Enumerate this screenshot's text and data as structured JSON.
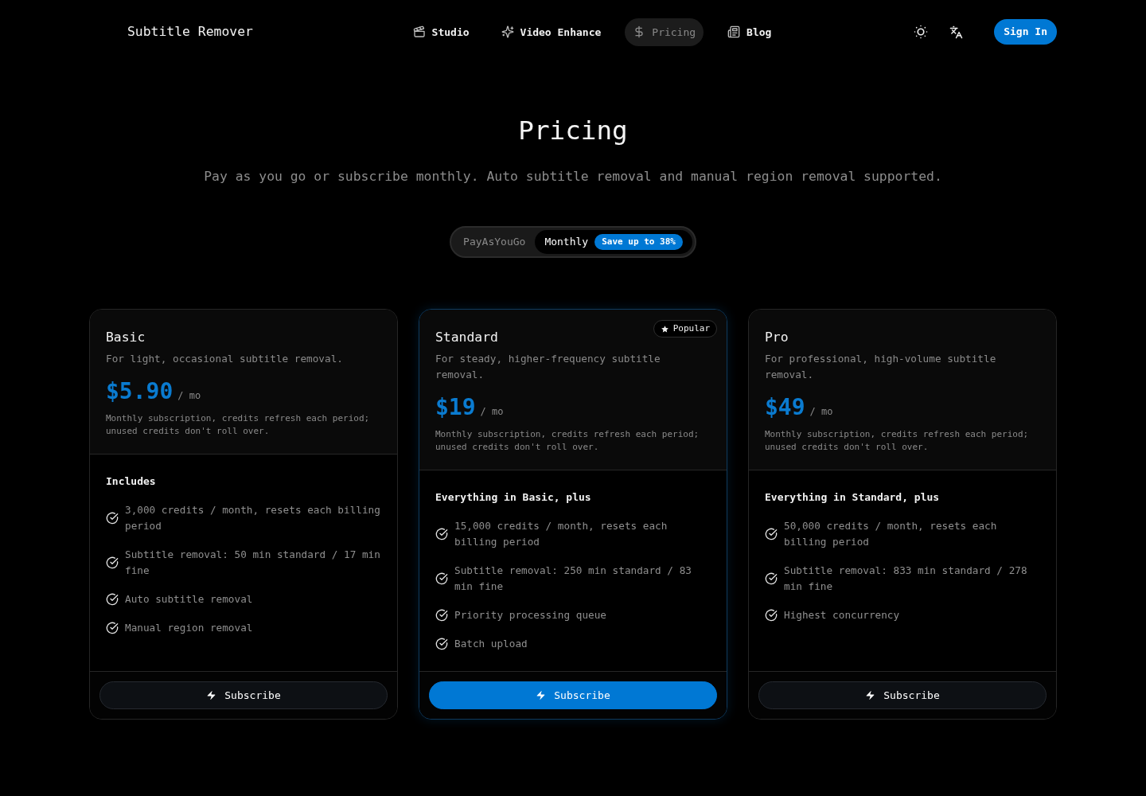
{
  "header": {
    "brand": "Subtitle Remover",
    "nav": [
      {
        "label": "Studio",
        "selected": false
      },
      {
        "label": "Video Enhance",
        "selected": false
      },
      {
        "label": "Pricing",
        "selected": true
      },
      {
        "label": "Blog",
        "selected": false
      }
    ],
    "sign_in": "Sign In"
  },
  "hero": {
    "title": "Pricing",
    "subtitle": "Pay as you go or subscribe monthly. Auto subtitle removal and manual region removal supported."
  },
  "billing_toggle": [
    {
      "label": "PayAsYouGo",
      "selected": false
    },
    {
      "label": "Monthly",
      "selected": true,
      "badge": "Save up to 38%"
    }
  ],
  "plans": [
    {
      "name": "Basic",
      "description": "For light, occasional subtitle removal.",
      "price": "$5.90",
      "period": "/ mo",
      "note": "Monthly subscription, credits refresh each period; unused credits don't roll over.",
      "features_heading": "Includes",
      "features": [
        "3,000 credits / month, resets each billing period",
        "Subtitle removal: 50 min standard / 17 min fine",
        "Auto subtitle removal",
        "Manual region removal"
      ],
      "button": "Subscribe",
      "featured": false
    },
    {
      "name": "Standard",
      "badge": "Popular",
      "description": "For steady, higher-frequency subtitle removal.",
      "price": "$19",
      "period": "/ mo",
      "note": "Monthly subscription, credits refresh each period; unused credits don't roll over.",
      "features_heading": "Everything in Basic, plus",
      "features": [
        "15,000 credits / month, resets each billing period",
        "Subtitle removal: 250 min standard / 83 min fine",
        "Priority processing queue",
        "Batch upload"
      ],
      "button": "Subscribe",
      "featured": true
    },
    {
      "name": "Pro",
      "description": "For professional, high-volume subtitle removal.",
      "price": "$49",
      "period": "/ mo",
      "note": "Monthly subscription, credits refresh each period; unused credits don't roll over.",
      "features_heading": "Everything in Standard, plus",
      "features": [
        "50,000 credits / month, resets each billing period",
        "Subtitle removal: 833 min standard / 278 min fine",
        "Highest concurrency"
      ],
      "button": "Subscribe",
      "featured": false
    }
  ]
}
